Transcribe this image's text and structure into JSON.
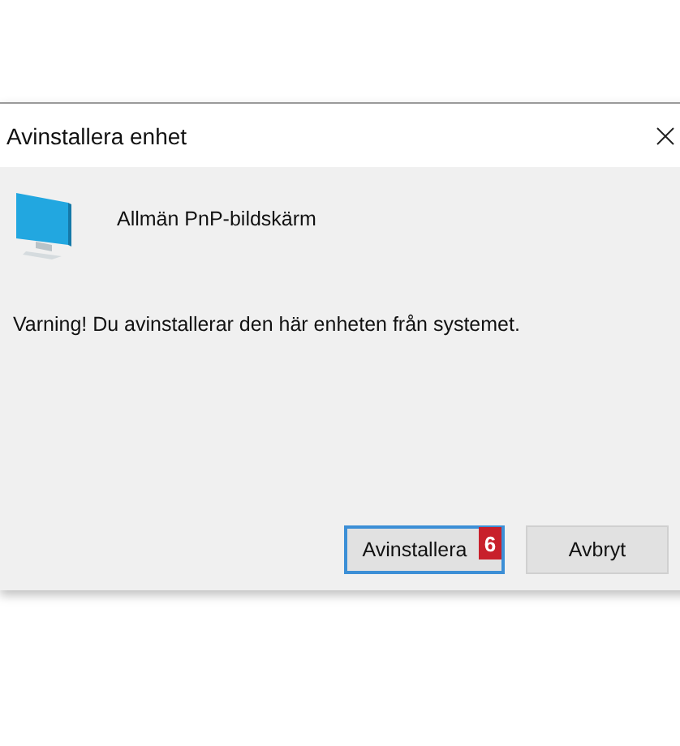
{
  "window": {
    "title": "Avinstallera enhet"
  },
  "device": {
    "name": "Allmän PnP-bildskärm"
  },
  "warning": "Varning! Du avinstallerar den här enheten från systemet.",
  "buttons": [
    {
      "label": "Avinstallera",
      "selected": true,
      "badge": "6"
    },
    {
      "label": "Avbryt",
      "selected": false
    }
  ]
}
